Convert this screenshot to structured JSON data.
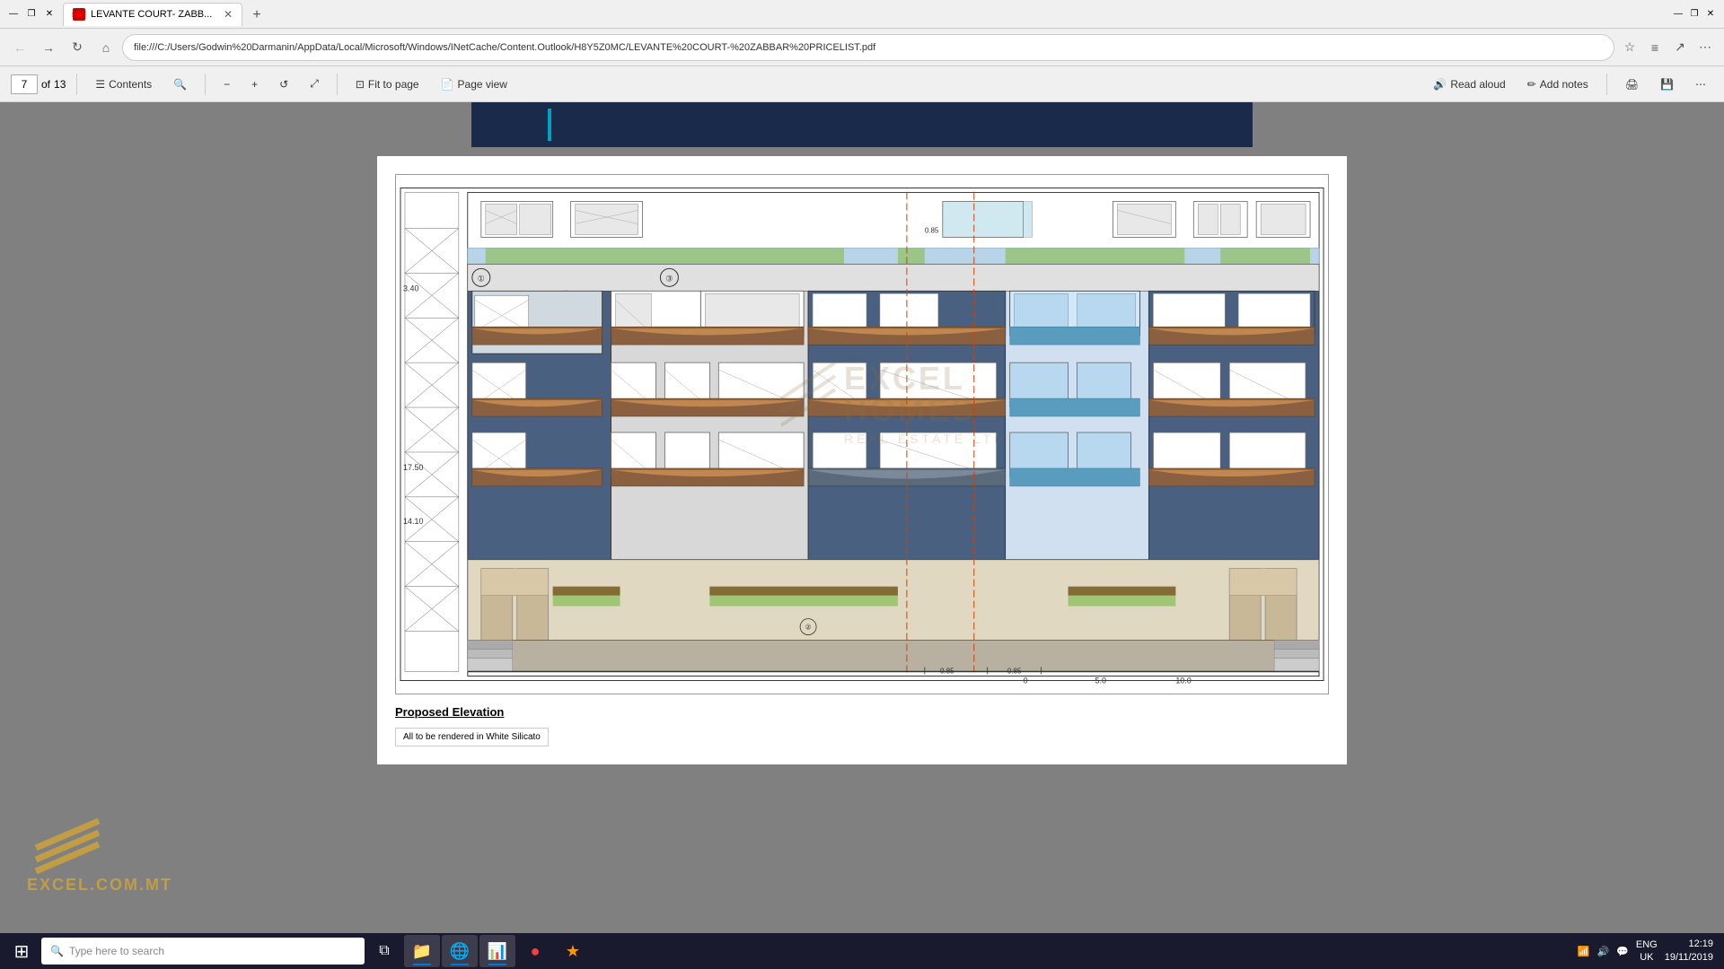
{
  "browser": {
    "title_bar": {
      "tab_label": "LEVANTE COURT- ZABB...",
      "tab_favicon": "PDF",
      "new_tab_label": "+"
    },
    "nav": {
      "back_btn": "←",
      "forward_btn": "→",
      "refresh_btn": "↺",
      "home_btn": "⌂",
      "address": "file:///C:/Users/Godwin%20Darmanin/AppData/Local/Microsoft/Windows/INetCache/Content.Outlook/H8Y5Z0MC/LEVANTE%20COURT-%20ZABBAR%20PRICELIST.pdf",
      "bookmark_icon": "☆",
      "reading_list_icon": "📋",
      "share_icon": "↗",
      "more_icon": "..."
    },
    "toolbar": {
      "page_current": "7",
      "page_total": "13",
      "contents_label": "Contents",
      "search_icon": "🔍",
      "zoom_out": "−",
      "zoom_in": "+",
      "rotate_icon": "↺",
      "fullscreen_icon": "⤢",
      "fit_to_page_label": "Fit to page",
      "page_view_label": "Page view",
      "read_aloud_label": "Read aloud",
      "add_notes_label": "Add notes",
      "print_icon": "🖨",
      "save_icon": "💾",
      "more_icon": "⋯"
    }
  },
  "pdf": {
    "page_label": "Proposed Elevation",
    "legend_text": "All to be rendered in White Silicato",
    "drawing_label": "Proposed Elevation",
    "watermark": {
      "company_name": "EXCEL",
      "company_name2": "HOMES",
      "tagline": "REAL ESTATE LTD"
    }
  },
  "taskbar": {
    "search_placeholder": "Type here to search",
    "start_icon": "⊞",
    "search_icon": "🔍",
    "apps": [
      {
        "name": "Task View",
        "icon": "⧉"
      },
      {
        "name": "File Explorer",
        "icon": "📁"
      },
      {
        "name": "Edge",
        "icon": "🌐"
      },
      {
        "name": "Excel",
        "icon": "📊"
      },
      {
        "name": "Chrome",
        "icon": "●"
      },
      {
        "name": "App6",
        "icon": "★"
      }
    ],
    "systray": {
      "language": "ENG",
      "region": "UK",
      "time": "12:19",
      "date": "19/11/2019",
      "notifications": "🔔",
      "volume": "🔊",
      "network": "📶"
    }
  }
}
